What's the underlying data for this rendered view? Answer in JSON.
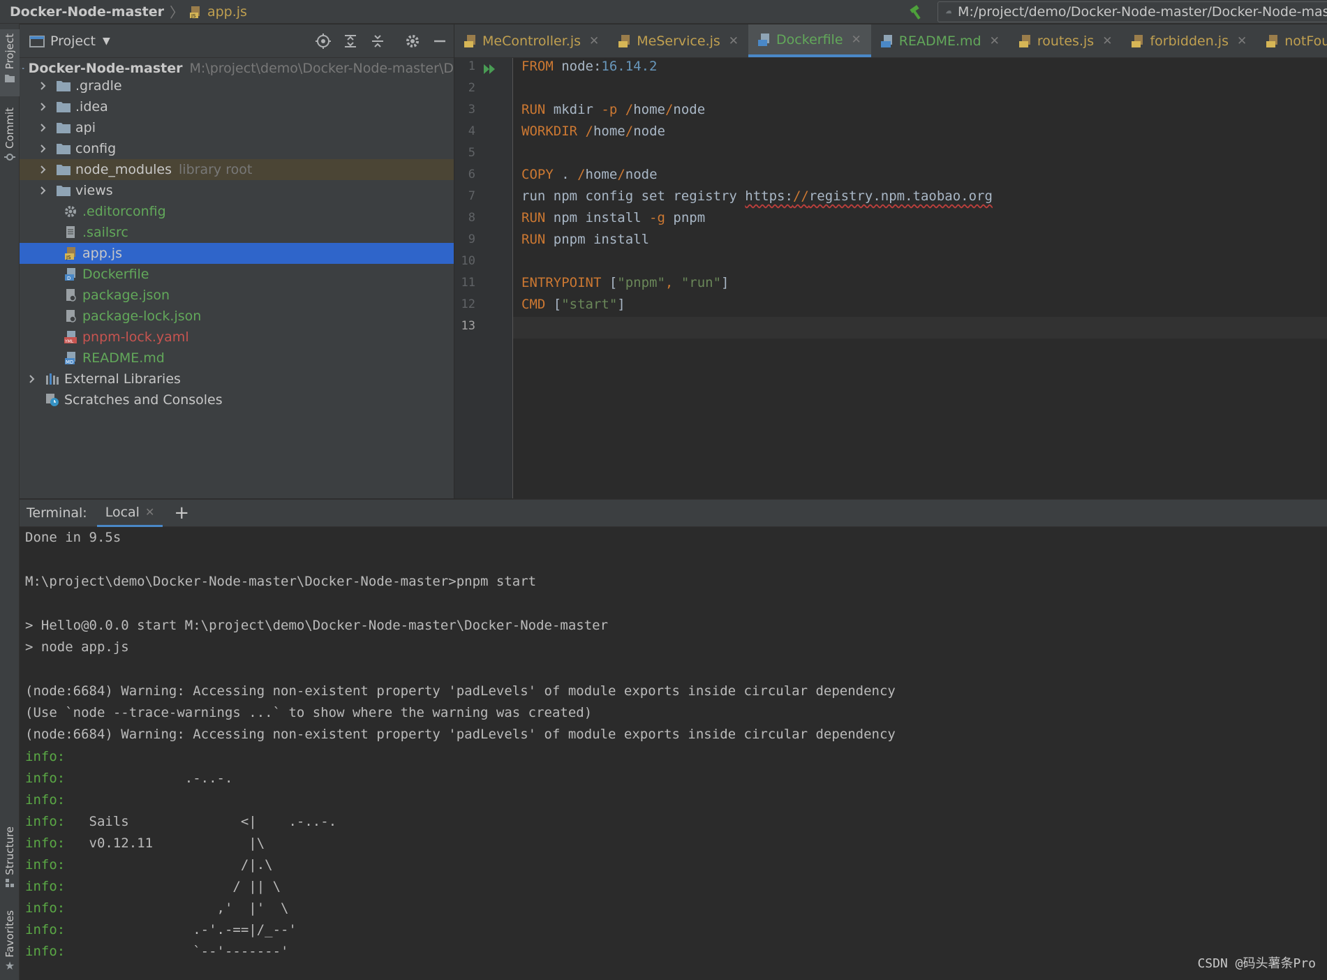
{
  "breadcrumb": {
    "project": "Docker-Node-master",
    "separator": "〉",
    "file": "app.js"
  },
  "run_config": {
    "path": "M:/project/demo/Docker-Node-master/Docker-Node-mast"
  },
  "left_strip": {
    "project": "Project",
    "commit": "Commit",
    "structure": "Structure",
    "favorites": "Favorites"
  },
  "project_panel": {
    "title": "Project",
    "tree": [
      {
        "label": "Docker-Node-master",
        "hint": "M:\\project\\demo\\Docker-Node-master\\D",
        "kind": "root"
      },
      {
        "label": ".gradle",
        "kind": "folder"
      },
      {
        "label": ".idea",
        "kind": "folder"
      },
      {
        "label": "api",
        "kind": "folder"
      },
      {
        "label": "config",
        "kind": "folder"
      },
      {
        "label": "node_modules",
        "hint": "library root",
        "kind": "folder"
      },
      {
        "label": "views",
        "kind": "folder"
      },
      {
        "label": ".editorconfig",
        "kind": "gear-file"
      },
      {
        "label": ".sailsrc",
        "kind": "file"
      },
      {
        "label": "app.js",
        "kind": "js-file"
      },
      {
        "label": "Dockerfile",
        "kind": "docker-file"
      },
      {
        "label": "package.json",
        "kind": "json-file"
      },
      {
        "label": "package-lock.json",
        "kind": "json-file"
      },
      {
        "label": "pnpm-lock.yaml",
        "kind": "yaml-file"
      },
      {
        "label": "README.md",
        "kind": "md-file"
      },
      {
        "label": "External Libraries",
        "kind": "libraries"
      },
      {
        "label": "Scratches and Consoles",
        "kind": "scratches"
      }
    ]
  },
  "editor": {
    "tabs": [
      {
        "label": "MeController.js"
      },
      {
        "label": "MeService.js"
      },
      {
        "label": "Dockerfile"
      },
      {
        "label": "README.md"
      },
      {
        "label": "routes.js"
      },
      {
        "label": "forbidden.js"
      },
      {
        "label": "notFound.js"
      }
    ],
    "active_tab": "Dockerfile",
    "line_numbers": [
      "1",
      "2",
      "3",
      "4",
      "5",
      "6",
      "7",
      "8",
      "9",
      "10",
      "11",
      "12",
      "13"
    ],
    "code": {
      "l1": {
        "kw": "FROM",
        "a": " node:",
        "num": "16.14.2"
      },
      "l3": {
        "kw": "RUN",
        "a": " mkdir ",
        "flag": "-p",
        "b": " ",
        "s1": "/",
        "c": "home",
        "s2": "/",
        "d": "node"
      },
      "l4": {
        "kw": "WORKDIR",
        "a": " ",
        "s1": "/",
        "c": "home",
        "s2": "/",
        "d": "node"
      },
      "l6": {
        "kw": "COPY",
        "a": " . ",
        "s1": "/",
        "c": "home",
        "s2": "/",
        "d": "node"
      },
      "l7": {
        "a": "run npm config set registry ",
        "url_a": "https:",
        "url_s": "//",
        "url_b": "registry.npm.taobao.org"
      },
      "l8": {
        "kw": "RUN",
        "a": " npm install ",
        "flag": "-g",
        "b": " pnpm"
      },
      "l9": {
        "kw": "RUN",
        "a": " pnpm install"
      },
      "l11": {
        "kw": "ENTRYPOINT",
        "a": " [",
        "s1": "\"pnpm\"",
        "b": ", ",
        "s2": "\"run\"",
        "c": "]"
      },
      "l12": {
        "kw": "CMD",
        "a": " [",
        "s1": "\"start\"",
        "c": "]"
      }
    }
  },
  "terminal": {
    "label": "Terminal:",
    "tab": "Local",
    "lines": {
      "t1": "Done in 9.5s",
      "t3": "M:\\project\\demo\\Docker-Node-master\\Docker-Node-master>pnpm start",
      "t5": "> Hello@0.0.0 start M:\\project\\demo\\Docker-Node-master\\Docker-Node-master",
      "t6": "> node app.js",
      "t8": "(node:6684) Warning: Accessing non-existent property 'padLevels' of module exports inside circular dependency",
      "t9": "(Use `node --trace-warnings ...` to show where the warning was created)",
      "t10": "(node:6684) Warning: Accessing non-existent property 'padLevels' of module exports inside circular dependency"
    },
    "info_prefix": "info:",
    "info_lines": [
      "",
      "               .-..-.",
      "",
      "   Sails              <|    .-..-.",
      "   v0.12.11            |\\",
      "                      /|.\\",
      "                     / || \\",
      "                   ,'  |'  \\",
      "                .-'.-==|/_--'",
      "                `--'-------'"
    ]
  },
  "watermark": "CSDN @码头薯条Pro",
  "colors": {
    "keyword": "#cc7832",
    "number": "#6897bb",
    "string": "#6a8759",
    "info": "#5aa845",
    "selection": "#2f65ca"
  }
}
